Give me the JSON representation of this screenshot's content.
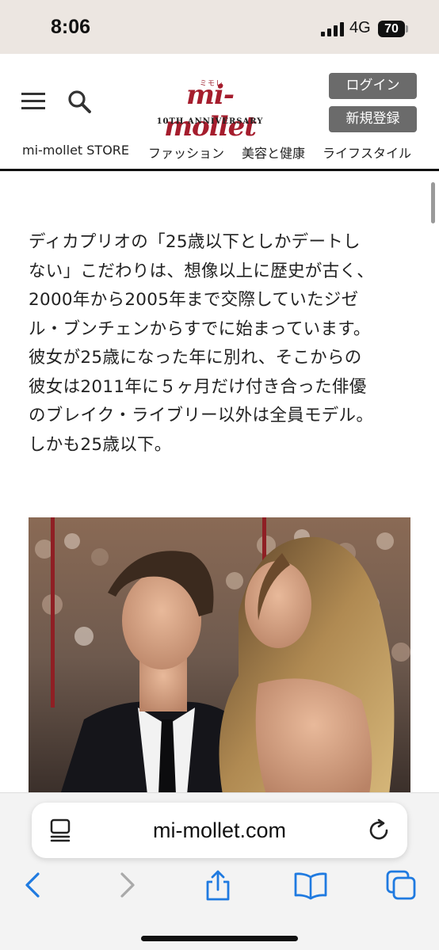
{
  "status_bar": {
    "time": "8:06",
    "network": "4G",
    "battery": "70"
  },
  "header": {
    "logo_ruby": "ミモレ",
    "logo_text": "mi-mollet",
    "logo_anniversary": "10TH ANNIVERSARY",
    "login_label": "ログイン",
    "register_label": "新規登録",
    "menu_icon": "hamburger-menu-icon",
    "search_icon": "search-icon",
    "nav": [
      "mi-mollet STORE",
      "ファッション",
      "美容と健康",
      "ライフスタイル"
    ]
  },
  "article": {
    "lines": [
      "ディカプリオの「25歳以下としかデートし",
      "ない」こだわりは、想像以上に歴史が古く、",
      "2000年から2005年まで交際していたジゼ",
      "ル・ブンチェンからすでに始まっています。",
      "彼女が25歳になった年に別れ、そこからの",
      "彼女は2011年に５ヶ月だけ付き合った俳優",
      "のブレイク・ライブリー以外は全員モデル。",
      "しかも25歳以下。"
    ]
  },
  "browser": {
    "url": "mi-mollet.com",
    "toolbar_icons": [
      "back-icon",
      "forward-icon",
      "share-icon",
      "bookmarks-icon",
      "tabs-icon"
    ]
  },
  "colors": {
    "brand": "#a51d2d",
    "status_bar_bg": "#ece6e1",
    "button_gray": "#6b6b6b",
    "ios_blue": "#1f7ae0"
  }
}
